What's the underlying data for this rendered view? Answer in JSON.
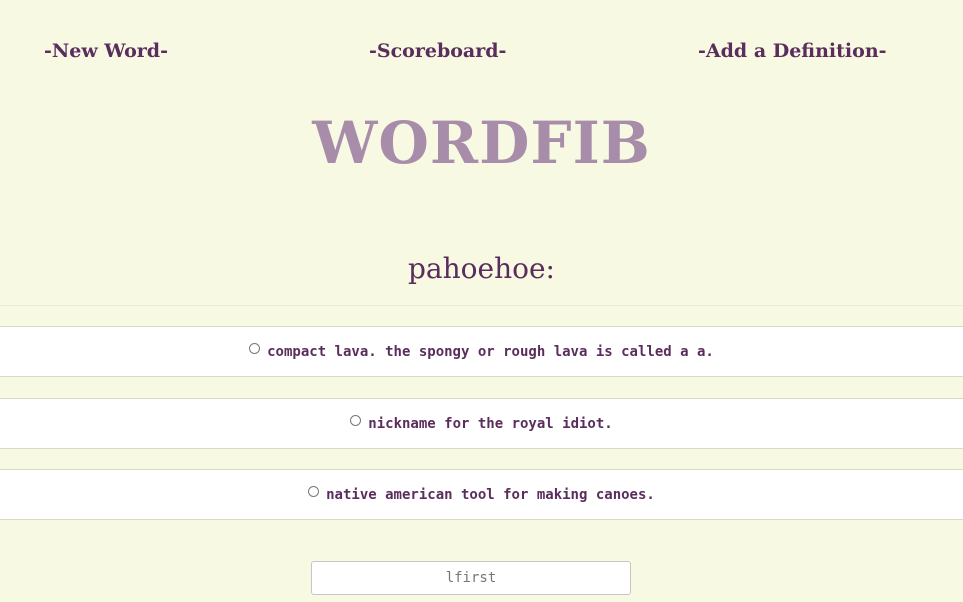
{
  "nav": {
    "new_word": "-New Word-",
    "scoreboard": "-Scoreboard-",
    "add_definition": "-Add a Definition-"
  },
  "logo": "WORDFIB",
  "word": "pahoehoe:",
  "options": [
    {
      "label": "compact lava. the spongy or rough lava is called a a."
    },
    {
      "label": "nickname for the royal idiot."
    },
    {
      "label": "native american tool for making canoes."
    }
  ],
  "name_input": {
    "value": "lfirst"
  },
  "colors": {
    "background": "#f7f9e2",
    "text": "#5a2d5c",
    "logo": "#a88daa"
  }
}
